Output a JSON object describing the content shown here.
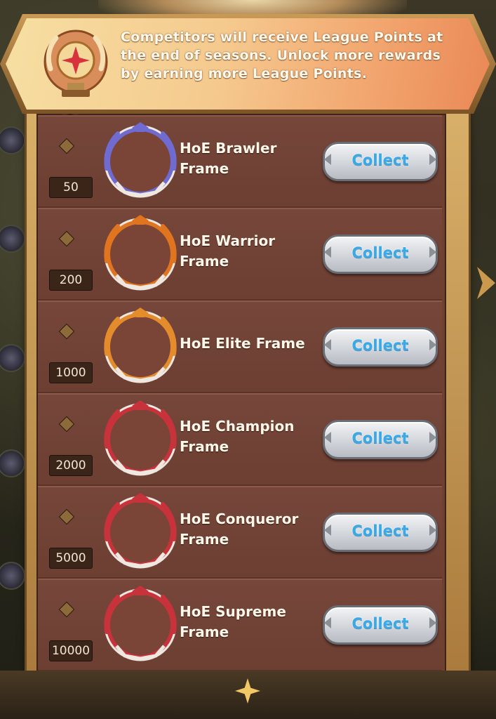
{
  "banner": {
    "text": "Competitors will receive League Points at the end of seasons. Unlock more rewards by earning more League Points."
  },
  "rewards": [
    {
      "points": "50",
      "name": "HoE Brawler Frame",
      "button": "Collect",
      "frame_color": "#6f6bd0"
    },
    {
      "points": "200",
      "name": "HoE Warrior Frame",
      "button": "Collect",
      "frame_color": "#e0741f"
    },
    {
      "points": "1000",
      "name": "HoE Elite Frame",
      "button": "Collect",
      "frame_color": "#e48b2c"
    },
    {
      "points": "2000",
      "name": "HoE Champion Frame",
      "button": "Collect",
      "frame_color": "#c8323a"
    },
    {
      "points": "5000",
      "name": "HoE Conqueror Frame",
      "button": "Collect",
      "frame_color": "#c8323a"
    },
    {
      "points": "10000",
      "name": "HoE Supreme Frame",
      "button": "Collect",
      "frame_color": "#c8323a"
    }
  ],
  "colors": {
    "collect_text": "#39a9e8",
    "row_bg": "#6c3f32",
    "banner_start": "#f6dfa2",
    "banner_end": "#e98856"
  }
}
